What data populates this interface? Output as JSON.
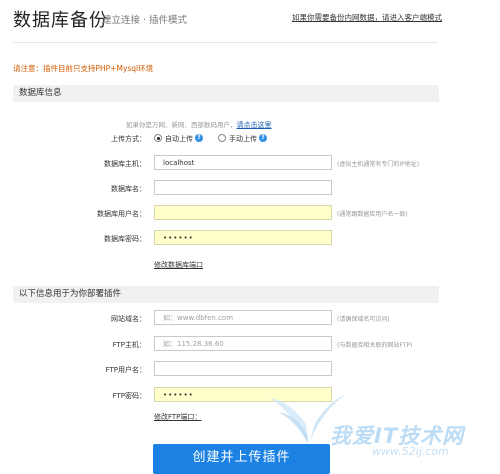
{
  "header": {
    "title": "数据库备份",
    "subtitle": "建立连接 · 插件模式",
    "client_link": "如果你需要备份内网数据，请进入客户端模式"
  },
  "notice": "请注意：插件目前只支持PHP+Mysql环境",
  "db_section": {
    "title": "数据库信息",
    "hint": "如果你是万网、新网、西部数码用户，",
    "hint_link": "请点击这里",
    "upload_mode_label": "上传方式：",
    "upload_options": [
      {
        "label": "自动上传",
        "selected": true
      },
      {
        "label": "手动上传",
        "selected": false
      }
    ],
    "help_icon_text": "?",
    "fields": [
      {
        "label": "数据库主机：",
        "value": "localhost",
        "placeholder": "",
        "note": "(虚拟主机通常有专门的IP地址)",
        "highlighted": false
      },
      {
        "label": "数据库名：",
        "value": "",
        "placeholder": "",
        "note": "",
        "highlighted": false
      },
      {
        "label": "数据库用户名：",
        "value": "",
        "placeholder": "",
        "note": "(通常跟数据库用户名一致)",
        "highlighted": true
      },
      {
        "label": "数据库密码：",
        "value": "••••••",
        "placeholder": "",
        "note": "",
        "highlighted": true
      }
    ],
    "edit_port_link": "修改数据库端口"
  },
  "deploy_section": {
    "title": "以下信息用于为你部署插件",
    "fields": [
      {
        "label": "网站域名：",
        "value": "",
        "placeholder": "如：www.dbfen.com",
        "note": "(请确保域名可访问)",
        "highlighted": false
      },
      {
        "label": "FTP主机：",
        "value": "",
        "placeholder": "如：115.28.36.60",
        "note": "(与数据库相关联的网站FTP)",
        "highlighted": false
      },
      {
        "label": "FTP用户名：",
        "value": "",
        "placeholder": "",
        "note": "",
        "highlighted": false
      },
      {
        "label": "FTP密码：",
        "value": "••••••",
        "placeholder": "",
        "note": "",
        "highlighted": true
      }
    ],
    "edit_port_link": "修改FTP端口："
  },
  "submit_button": "创建并上传插件",
  "watermark": {
    "text": "我爱IT技术网",
    "url": "www.52ij.com"
  },
  "colors": {
    "accent": "#1b82e3",
    "notice": "#d25a00",
    "highlight_field": "#ffffcc"
  }
}
